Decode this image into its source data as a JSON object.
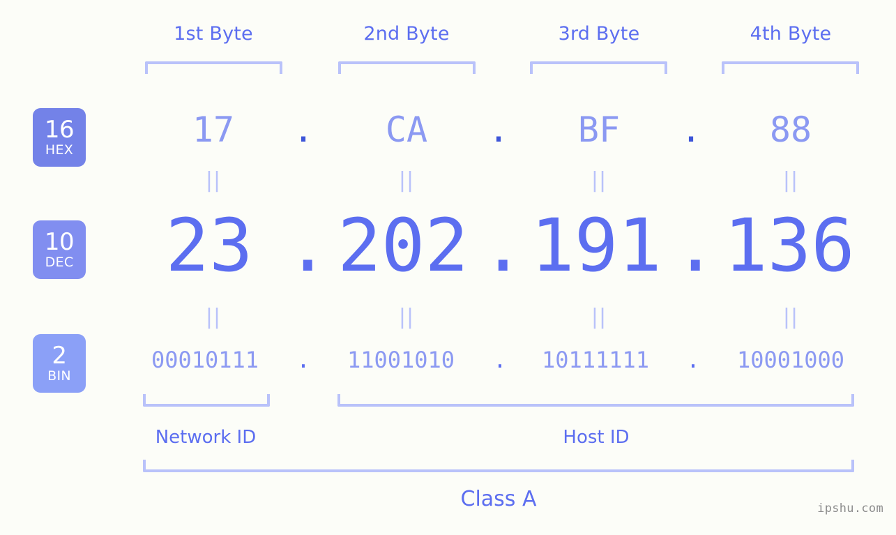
{
  "bytes": [
    {
      "header": "1st Byte",
      "hex": "17",
      "dec": "23",
      "bin": "00010111"
    },
    {
      "header": "2nd Byte",
      "hex": "CA",
      "dec": "202",
      "bin": "11001010"
    },
    {
      "header": "3rd Byte",
      "hex": "BF",
      "dec": "191",
      "bin": "10111111"
    },
    {
      "header": "4th Byte",
      "hex": "88",
      "dec": "136",
      "bin": "10001000"
    }
  ],
  "radix": {
    "hex": {
      "base": "16",
      "name": "HEX",
      "color": "#7382e8"
    },
    "dec": {
      "base": "10",
      "name": "DEC",
      "color": "#818ef0"
    },
    "bin": {
      "base": "2",
      "name": "BIN",
      "color": "#8ba0f7"
    }
  },
  "separators": {
    "dot": ".",
    "equals": "||"
  },
  "sections": {
    "network_id": "Network ID",
    "host_id": "Host ID",
    "class": "Class A"
  },
  "watermark": "ipshu.com",
  "colors": {
    "background": "#fcfdf8",
    "accent": "#5c6ef0",
    "accent_light": "#8b99f2",
    "bracket": "#b9c2fa",
    "dot_hex": "#3d55d8"
  }
}
